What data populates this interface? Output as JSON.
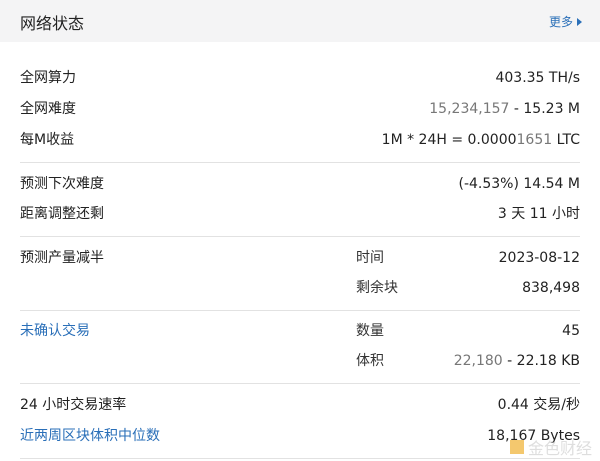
{
  "header": {
    "title": "网络状态",
    "more": "更多"
  },
  "rows": {
    "hashrate": {
      "label": "全网算力",
      "value": "403.35 TH/s"
    },
    "difficulty": {
      "label": "全网难度",
      "value_raw": "15,234,157",
      "value_sep": " - ",
      "value_short": "15.23 M"
    },
    "earnings": {
      "label": "每M收益",
      "value_prefix": "1M * 24H = 0.0000",
      "value_gray": "1651",
      "value_suffix": " LTC"
    },
    "next_difficulty": {
      "label": "预测下次难度",
      "value": "(-4.53%) 14.54 M"
    },
    "adjust_remaining": {
      "label": "距离调整还剩",
      "value": "3 天 11 小时"
    },
    "halving": {
      "label": "预测产量减半",
      "time_label": "时间",
      "time_value": "2023-08-12",
      "blocks_label": "剩余块",
      "blocks_value": "838,498"
    },
    "unconfirmed": {
      "label": "未确认交易",
      "count_label": "数量",
      "count_value": "45",
      "size_label": "体积",
      "size_raw": "22,180",
      "size_sep": " - ",
      "size_short": "22.18 KB"
    },
    "tx_rate": {
      "label": "24 小时交易速率",
      "value": "0.44 交易/秒"
    },
    "median_block": {
      "label": "近两周区块体积中位数",
      "value": "18,167 Bytes"
    }
  },
  "watermark": "金色财经"
}
